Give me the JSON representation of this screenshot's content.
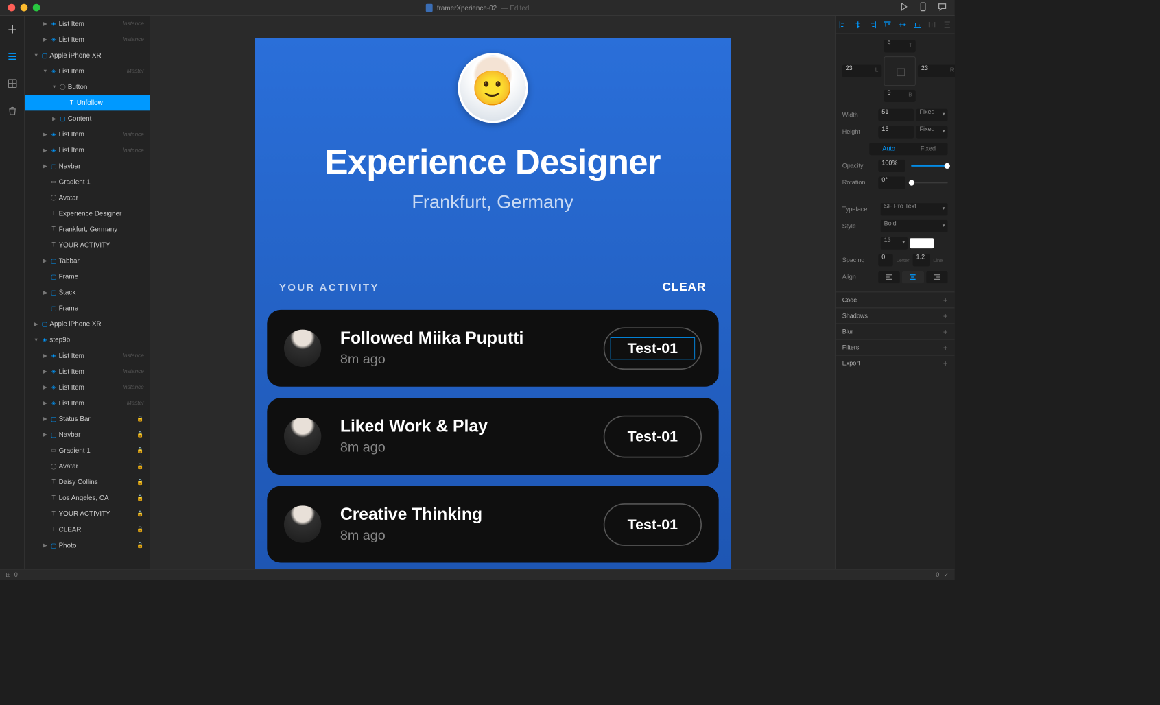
{
  "window": {
    "filename": "framerXperience-02",
    "status": "Edited"
  },
  "layers": [
    {
      "indent": 1,
      "icon": "component",
      "label": "List Item",
      "tag": "Instance",
      "disclosure": "right"
    },
    {
      "indent": 1,
      "icon": "component",
      "label": "List Item",
      "tag": "Instance",
      "disclosure": "right"
    },
    {
      "indent": 0,
      "icon": "frame",
      "label": "Apple iPhone XR",
      "disclosure": "down"
    },
    {
      "indent": 1,
      "icon": "component",
      "label": "List Item",
      "tag": "Master",
      "disclosure": "down"
    },
    {
      "indent": 2,
      "icon": "circle",
      "label": "Button",
      "disclosure": "down"
    },
    {
      "indent": 3,
      "icon": "text",
      "label": "Unfollow",
      "selected": true
    },
    {
      "indent": 2,
      "icon": "frame",
      "label": "Content",
      "disclosure": "right"
    },
    {
      "indent": 1,
      "icon": "component",
      "label": "List Item",
      "tag": "Instance",
      "disclosure": "right"
    },
    {
      "indent": 1,
      "icon": "component",
      "label": "List Item",
      "tag": "Instance",
      "disclosure": "right"
    },
    {
      "indent": 1,
      "icon": "frame",
      "label": "Navbar",
      "disclosure": "right"
    },
    {
      "indent": 1,
      "icon": "shape",
      "label": "Gradient 1"
    },
    {
      "indent": 1,
      "icon": "circle",
      "label": "Avatar"
    },
    {
      "indent": 1,
      "icon": "text",
      "label": "Experience Designer"
    },
    {
      "indent": 1,
      "icon": "text",
      "label": "Frankfurt, Germany"
    },
    {
      "indent": 1,
      "icon": "text",
      "label": "YOUR ACTIVITY"
    },
    {
      "indent": 1,
      "icon": "frame",
      "label": "Tabbar",
      "disclosure": "right"
    },
    {
      "indent": 1,
      "icon": "frame",
      "label": "Frame"
    },
    {
      "indent": 1,
      "icon": "frame",
      "label": "Stack",
      "disclosure": "right"
    },
    {
      "indent": 1,
      "icon": "frame",
      "label": "Frame"
    },
    {
      "indent": 0,
      "icon": "frame",
      "label": "Apple iPhone XR",
      "disclosure": "right"
    },
    {
      "indent": 0,
      "icon": "component",
      "label": "step9b",
      "disclosure": "down"
    },
    {
      "indent": 1,
      "icon": "component",
      "label": "List Item",
      "tag": "Instance",
      "disclosure": "right"
    },
    {
      "indent": 1,
      "icon": "component",
      "label": "List Item",
      "tag": "Instance",
      "disclosure": "right"
    },
    {
      "indent": 1,
      "icon": "component",
      "label": "List Item",
      "tag": "Instance",
      "disclosure": "right"
    },
    {
      "indent": 1,
      "icon": "component",
      "label": "List Item",
      "tag": "Master",
      "disclosure": "right"
    },
    {
      "indent": 1,
      "icon": "frame",
      "label": "Status Bar",
      "lock": true,
      "disclosure": "right"
    },
    {
      "indent": 1,
      "icon": "frame",
      "label": "Navbar",
      "lock": true,
      "disclosure": "right"
    },
    {
      "indent": 1,
      "icon": "shape",
      "label": "Gradient 1",
      "lock": true
    },
    {
      "indent": 1,
      "icon": "circle",
      "label": "Avatar",
      "lock": true
    },
    {
      "indent": 1,
      "icon": "text",
      "label": "Daisy Collins",
      "lock": true
    },
    {
      "indent": 1,
      "icon": "text",
      "label": "Los Angeles, CA",
      "lock": true
    },
    {
      "indent": 1,
      "icon": "text",
      "label": "YOUR ACTIVITY",
      "lock": true
    },
    {
      "indent": 1,
      "icon": "text",
      "label": "CLEAR",
      "lock": true
    },
    {
      "indent": 1,
      "icon": "frame",
      "label": "Photo",
      "lock": true,
      "disclosure": "right"
    }
  ],
  "canvas": {
    "hero_title": "Experience Designer",
    "hero_sub": "Frankfurt, Germany",
    "activity_label": "YOUR  ACTIVITY",
    "clear": "CLEAR",
    "items": [
      {
        "title": "Followed Miika Puputti",
        "time": "8m ago",
        "btn": "Test-01",
        "sel": true
      },
      {
        "title": "Liked Work & Play",
        "time": "8m ago",
        "btn": "Test-01"
      },
      {
        "title": "Creative Thinking",
        "time": "8m ago",
        "btn": "Test-01"
      }
    ]
  },
  "inspector": {
    "pos_top": "9",
    "pos_left": "23",
    "pos_right": "23",
    "pos_bottom": "9",
    "width_label": "Width",
    "width_val": "51",
    "width_mode": "Fixed",
    "height_label": "Height",
    "height_val": "15",
    "height_mode": "Fixed",
    "size_auto": "Auto",
    "size_fixed": "Fixed",
    "opacity_label": "Opacity",
    "opacity_val": "100%",
    "rotation_label": "Rotation",
    "rotation_val": "0°",
    "typeface_label": "Typeface",
    "typeface_val": "SF Pro Text",
    "style_label": "Style",
    "style_val": "Bold",
    "fontsize_val": "13",
    "spacing_label": "Spacing",
    "letter_val": "0",
    "letter_hint": "Letter",
    "line_val": "1.2",
    "line_hint": "Line",
    "align_label": "Align",
    "sections": {
      "code": "Code",
      "shadows": "Shadows",
      "blur": "Blur",
      "filters": "Filters",
      "export": "Export"
    }
  },
  "statusbar": {
    "left": "0",
    "right": "0"
  }
}
